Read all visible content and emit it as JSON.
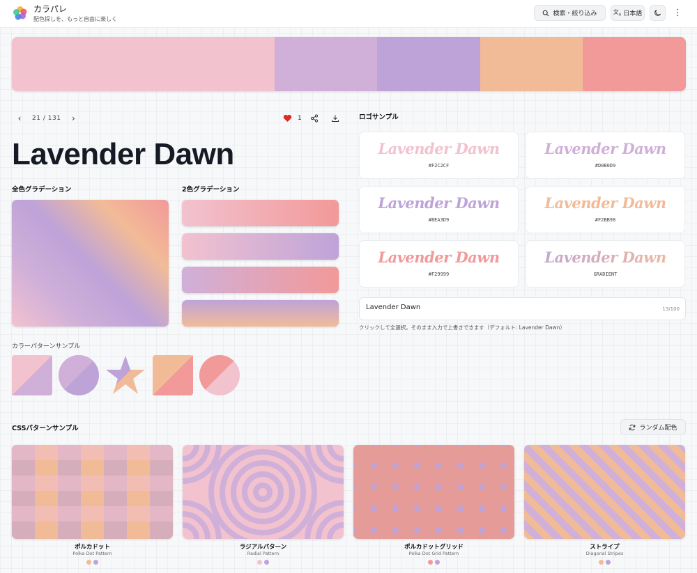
{
  "app": {
    "name": "カラパレ",
    "tagline": "配色探しを、もっと自由に楽しく"
  },
  "header": {
    "search_label": "検索・絞り込み",
    "lang_label": "日本語"
  },
  "palette": {
    "colors": [
      "#F2C2CF",
      "#D0B0D9",
      "#BEA3D9",
      "#F2BB98",
      "#F29999"
    ]
  },
  "nav": {
    "current": "21",
    "separator": "/",
    "total": "131"
  },
  "actions": {
    "like_count": "1"
  },
  "title": "Lavender Dawn",
  "sections": {
    "full_gradient": "全色グラデーション",
    "two_gradient": "2色グラデーション",
    "color_pattern": "カラーパターンサンプル",
    "logo_sample": "ロゴサンプル",
    "css_pattern": "CSSパターンサンプル"
  },
  "logos": [
    {
      "text": "Lavender Dawn",
      "code": "#F2C2CF"
    },
    {
      "text": "Lavender Dawn",
      "code": "#D0B0D9"
    },
    {
      "text": "Lavender Dawn",
      "code": "#BEA3D9"
    },
    {
      "text": "Lavender Dawn",
      "code": "#F2BB98"
    },
    {
      "text": "Lavender Dawn",
      "code": "#F29999"
    },
    {
      "text": "Lavender Dawn",
      "code": "GRADIENT"
    }
  ],
  "logo_input": {
    "value": "Lavender Dawn",
    "count": "13/100",
    "hint": "クリックして全選択。そのまま入力で上書きできます（デフォルト: Lavender Dawn）"
  },
  "random_button": "ランダム配色",
  "css_patterns": [
    {
      "name": "ポルカドット",
      "sub": "Polka Dot Pattern",
      "dots": [
        "#F2BB98",
        "#BEA3D9"
      ]
    },
    {
      "name": "ラジアルパターン",
      "sub": "Radial Pattern",
      "dots": [
        "#F2C2CF",
        "#BEA3D9"
      ]
    },
    {
      "name": "ポルカドットグリッド",
      "sub": "Polka Dot Grid Pattern",
      "dots": [
        "#F29999",
        "#BEA3D9"
      ]
    },
    {
      "name": "ストライプ",
      "sub": "Diagonal Stripes",
      "dots": [
        "#F2BB98",
        "#BEA3D9"
      ]
    }
  ]
}
